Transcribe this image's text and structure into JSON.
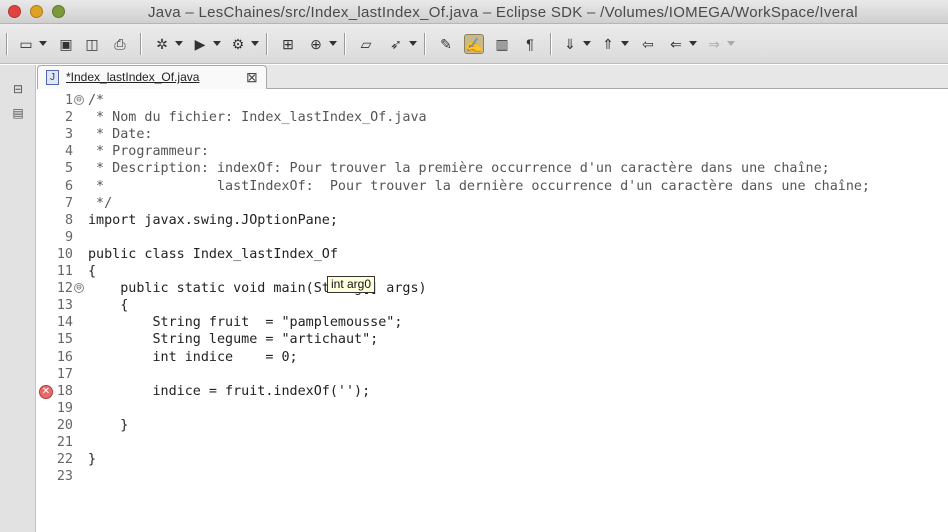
{
  "window": {
    "title": "Java – LesChaines/src/Index_lastIndex_Of.java – Eclipse SDK – /Volumes/IOMEGA/WorkSpace/Iveral"
  },
  "toolbar": {
    "icons": [
      "new-wizard-icon",
      "save-icon",
      "save-all-icon",
      "print-icon",
      "debug-icon",
      "run-icon",
      "external-tools-icon",
      "new-java-package-icon",
      "new-class-icon",
      "open-type-icon",
      "search-icon",
      "toggle-mark-occurrences-icon",
      "toggle-block-selection-icon",
      "show-whitespace-icon",
      "next-annotation-icon",
      "prev-annotation-icon",
      "back-icon",
      "forward-icon"
    ]
  },
  "editor": {
    "tab_label": "*Index_lastIndex_Of.java",
    "tab_close": "⊠",
    "lines": [
      {
        "n": "1",
        "fold": "⊖",
        "text": "/*"
      },
      {
        "n": "2",
        "text": " * Nom du fichier: Index_lastIndex_Of.java"
      },
      {
        "n": "3",
        "text": " * Date:"
      },
      {
        "n": "4",
        "text": " * Programmeur:"
      },
      {
        "n": "5",
        "text": " * Description: indexOf: Pour trouver la première occurrence d'un caractère dans une chaîne;"
      },
      {
        "n": "6",
        "text": " *              lastIndexOf:  Pour trouver la dernière occurrence d'un caractère dans une chaîne;"
      },
      {
        "n": "7",
        "text": " */"
      },
      {
        "n": "8",
        "text": "import javax.swing.JOptionPane;"
      },
      {
        "n": "9",
        "text": ""
      },
      {
        "n": "10",
        "text": "public class Index_lastIndex_Of"
      },
      {
        "n": "11",
        "text": "{"
      },
      {
        "n": "12",
        "fold": "⊖",
        "text": "    public static void main(String[] args)"
      },
      {
        "n": "13",
        "text": "    {"
      },
      {
        "n": "14",
        "text": "        String fruit  = \"pamplemousse\";"
      },
      {
        "n": "15",
        "text": "        String legume = \"artichaut\";"
      },
      {
        "n": "16",
        "text": "        int indice    = 0;"
      },
      {
        "n": "17",
        "text": ""
      },
      {
        "n": "18",
        "error": true,
        "text": "        indice = fruit.indexOf('');"
      },
      {
        "n": "19",
        "text": ""
      },
      {
        "n": "20",
        "text": "    }"
      },
      {
        "n": "21",
        "text": ""
      },
      {
        "n": "22",
        "text": "}"
      },
      {
        "n": "23",
        "text": ""
      }
    ],
    "hint": "int arg0",
    "error_marker": "✕"
  }
}
